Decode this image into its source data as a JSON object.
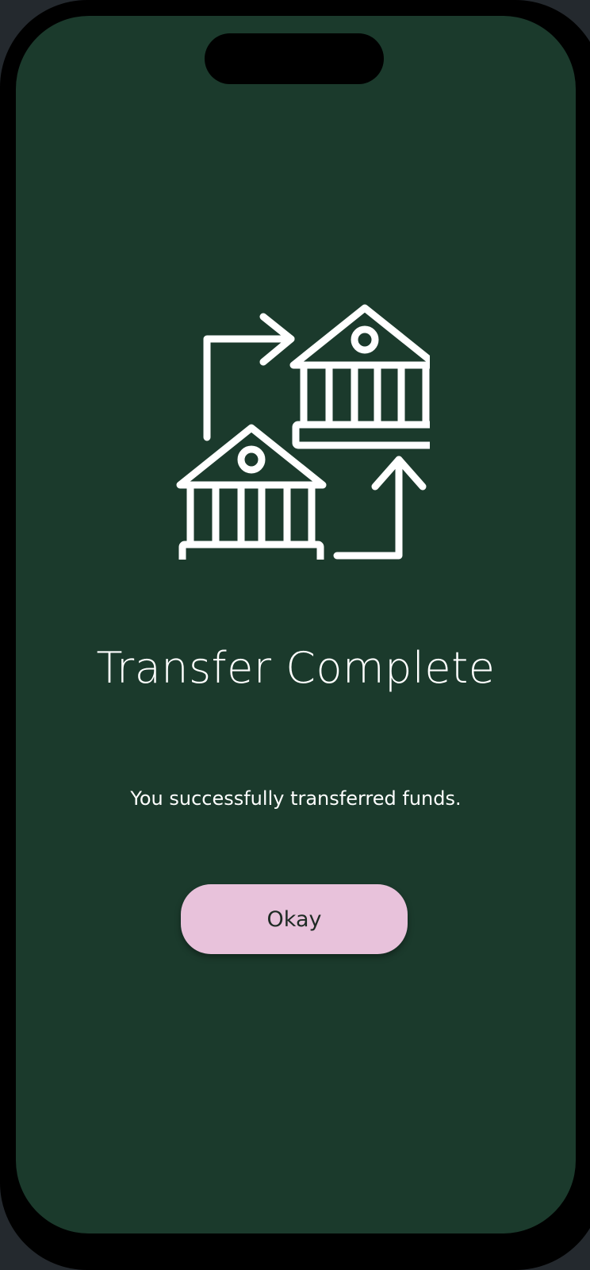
{
  "screen": {
    "title": "Transfer Complete",
    "message": "You successfully transferred funds.",
    "okay_label": "Okay"
  },
  "icons": {
    "illustration": "bank-transfer-icon",
    "bank_a": "bank-building-icon",
    "bank_b": "bank-building-icon",
    "arrow_a": "arrow-right-icon",
    "arrow_b": "arrow-up-icon"
  },
  "colors": {
    "background": "#1b3a2c",
    "frame": "#000000",
    "button_bg": "#e8c2db",
    "button_text": "#1e2a24",
    "text": "#ffffff"
  }
}
